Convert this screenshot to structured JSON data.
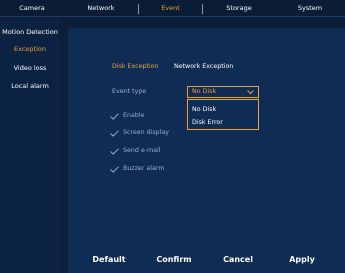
{
  "topnav": {
    "tabs": [
      {
        "label": "Camera",
        "active": false
      },
      {
        "label": "Network",
        "active": false
      },
      {
        "label": "Event",
        "active": true
      },
      {
        "label": "Storage",
        "active": false
      },
      {
        "label": "System",
        "active": false
      }
    ]
  },
  "sidebar": {
    "items": [
      {
        "label": "Motion Detection",
        "active": false
      },
      {
        "label": "Exception",
        "active": true
      },
      {
        "label": "Video loss",
        "active": false
      },
      {
        "label": "Local alarm",
        "active": false
      }
    ]
  },
  "subtabs": [
    {
      "label": "Disk Exception",
      "active": true
    },
    {
      "label": "Network Exception",
      "active": false
    }
  ],
  "form": {
    "event_type_label": "Event type",
    "event_type_value": "No Disk",
    "event_type_options": [
      "No Disk",
      "Disk Error"
    ],
    "checkboxes": [
      {
        "label": "Enable",
        "checked": true
      },
      {
        "label": "Screen display",
        "checked": true
      },
      {
        "label": "Send e-mail",
        "checked": true
      },
      {
        "label": "Buzzer alarm",
        "checked": true
      }
    ]
  },
  "buttons": {
    "default": "Default",
    "confirm": "Confirm",
    "cancel": "Cancel",
    "apply": "Apply"
  },
  "colors": {
    "background": "#0b1e3a",
    "panel": "#0f2c55",
    "accent": "#e8a43a",
    "muted_text": "#8fb0d8"
  }
}
